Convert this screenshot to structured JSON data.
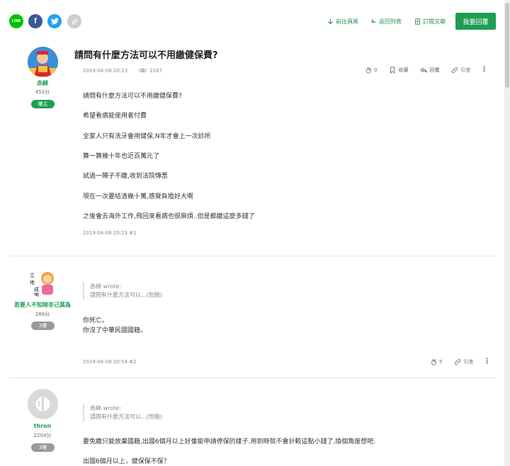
{
  "share": {
    "line_label": "LINE",
    "fb_label": "f",
    "tw_icon": "twitter-bird",
    "link_icon": "link-icon"
  },
  "topnav": {
    "home": "前往頁尾",
    "back": "返回列表",
    "subscribe": "訂閱文章",
    "reply": "我要回覆"
  },
  "thread": {
    "title": "請問有什麼方法可以不用繳健保費?",
    "posts": [
      {
        "author": "赤綿",
        "score": "452分",
        "badge": "樓主",
        "date": "2019-04-08 20:23",
        "views": "2167",
        "likes": "0",
        "collect": "收藏",
        "reply": "回覆",
        "quote": "引言",
        "lines": [
          "請問有什麼方法可以不用繳健保費?",
          "希望看病能使用者付費",
          "全家人只有洗牙會用健保,N年才會上一次診所",
          "算一算幾十年也近百萬元了",
          "試過一陣子不繳,收到法院傳票",
          "現在一次要結清幾十萬,感覺負擔好大啊",
          "之後會去海外工作,飛回來看病也很麻煩..但是都繳這麼多錢了"
        ],
        "footer": "2019-04-08 20:23 #1"
      },
      {
        "author": "若要人不知除非己莫為",
        "score": "289分",
        "badge": "2樓",
        "quote_author": "赤綿 wrote:",
        "quote_text": "請問有什麼方法可以...(恕刪)",
        "lines": [
          "你死亡。",
          "你沒了中華民國國籍。"
        ],
        "footer": "2019-04-08 20:54 #2",
        "likes": "5",
        "quote": "引言"
      },
      {
        "author": "thron",
        "score": "2204分",
        "badge": "3樓",
        "quote_author": "赤綿 wrote:",
        "quote_text": "請問有什麼方法可以...(恕刪)",
        "lines": [
          "要免繳只能放棄國籍,出國6個月以上好像能申請停保的樣子.用到時就不會計較這點小錢了,換個角度想吧.",
          "出國6個月以上，健保保不保？"
        ]
      }
    ]
  },
  "colors": {
    "accent": "#1f9d55",
    "line": "#00c300",
    "facebook": "#3b5998",
    "twitter": "#1da1f2"
  }
}
